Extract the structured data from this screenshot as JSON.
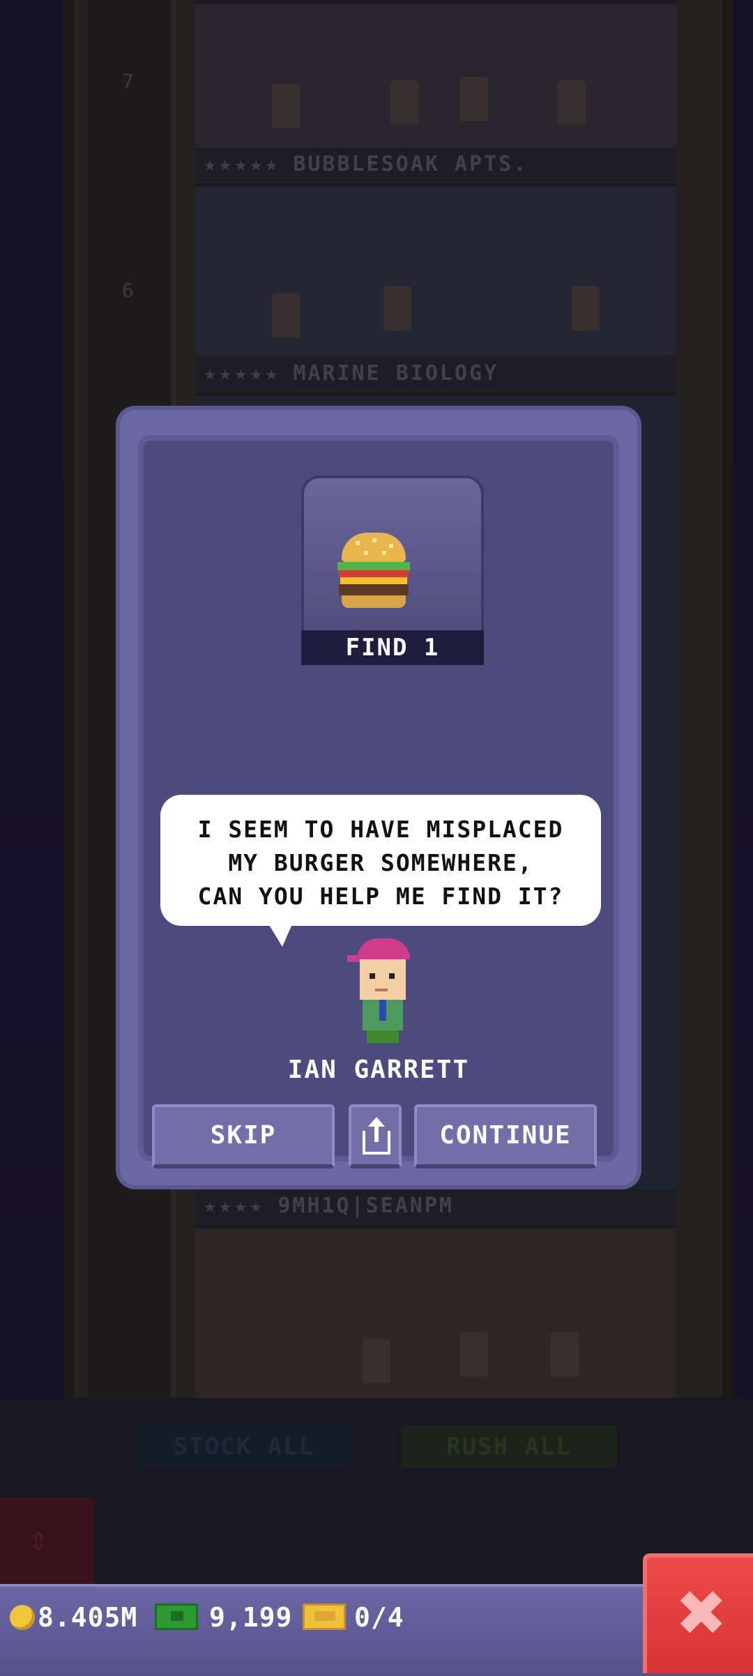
{
  "background": {
    "floor_numbers": [
      "7",
      "6"
    ],
    "floors": [
      {
        "name": "BUBBLESOAK APTS."
      },
      {
        "name": "MARINE BIOLOGY"
      },
      {
        "name": "9MH1Q|SEANPM"
      }
    ],
    "buttons": {
      "stock_all": "STOCK ALL",
      "rush_all": "RUSH ALL"
    }
  },
  "dialog": {
    "item_label": "FIND 1",
    "item_icon": "burger-icon",
    "speech_lines": [
      "I SEEM TO HAVE MISPLACED",
      "MY BURGER SOMEWHERE,",
      "CAN YOU HELP ME FIND IT?"
    ],
    "npc_name": "IAN GARRETT",
    "buttons": {
      "skip": "SKIP",
      "share_icon": "share-icon",
      "continue": "CONTINUE"
    }
  },
  "status": {
    "coins": "8.405M",
    "bux": "9,199",
    "tickets": "0/4",
    "close_icon": "close-icon"
  },
  "colors": {
    "dialog_frame": "#6b68a3",
    "dialog_inner": "#4d4a7e",
    "status_bar": "#5f5c96",
    "close_red": "#e03c3c"
  }
}
